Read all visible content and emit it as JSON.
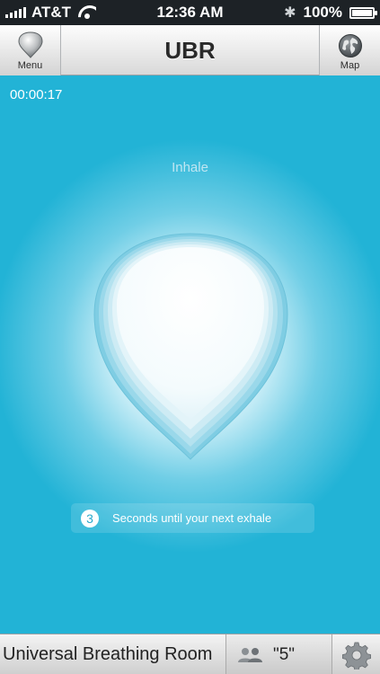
{
  "status_bar": {
    "carrier": "AT&T",
    "time": "12:36 AM",
    "battery": "100%",
    "signal_icon": "signal-bars-icon",
    "wifi_icon": "wifi-icon",
    "bluetooth_icon": "bluetooth-icon",
    "battery_icon": "battery-icon"
  },
  "nav": {
    "title": "UBR",
    "menu_label": "Menu",
    "map_label": "Map",
    "menu_icon": "drop-icon",
    "map_icon": "globe-icon"
  },
  "main": {
    "timer": "00:00:17",
    "phase": "Inhale",
    "countdown": "3",
    "countdown_message": "Seconds until your next exhale"
  },
  "bottom": {
    "room_name": "Universal Breathing Room",
    "people_count": "\"5\"",
    "people_icon": "people-icon",
    "settings_icon": "gear-icon"
  },
  "colors": {
    "background": "#22b3d6",
    "status_bar": "#1d2226",
    "accent": "#2aa9cc"
  }
}
